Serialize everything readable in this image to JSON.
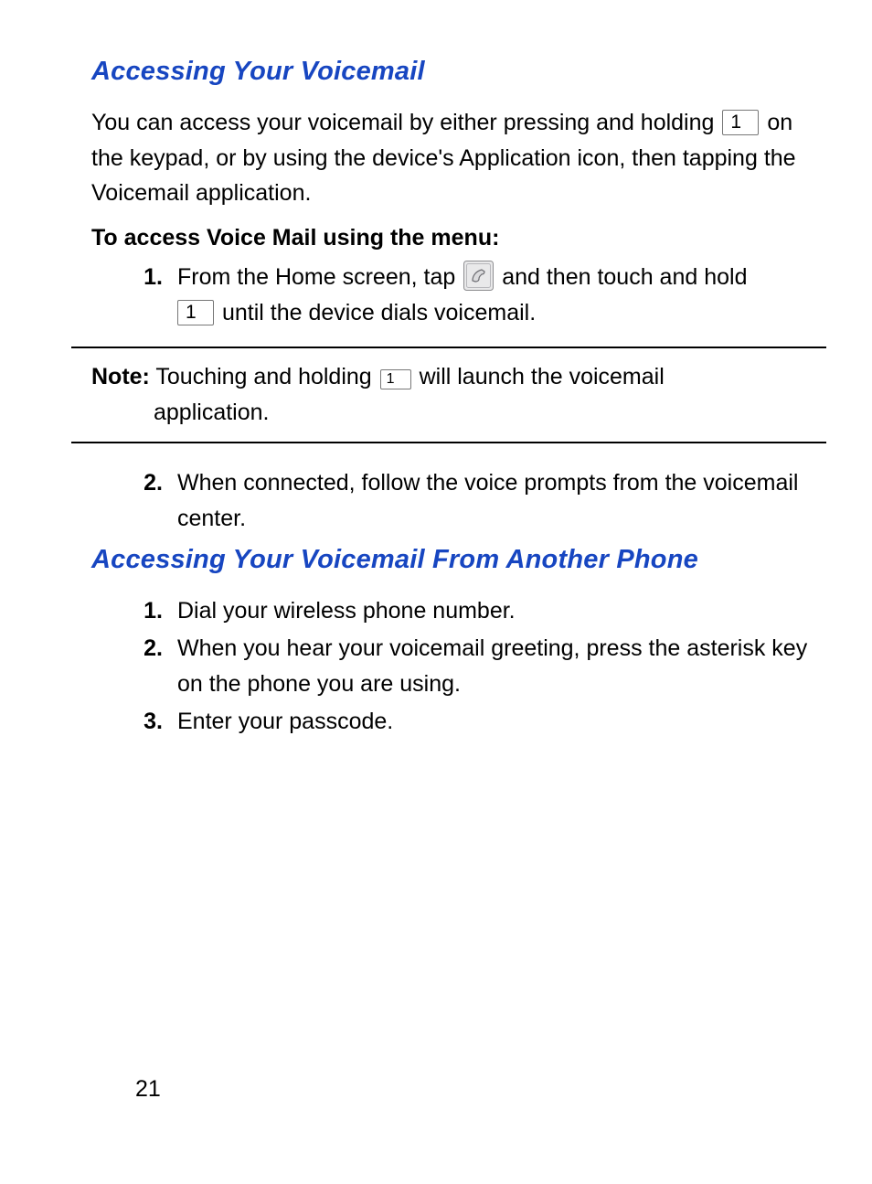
{
  "section1": {
    "title": "Accessing Your Voicemail",
    "intro_a": "You can access your voicemail by either pressing and holding ",
    "key1": "1",
    "intro_b": " on the keypad, or by using the device's Application icon, then tapping the Voicemail application.",
    "subhead": "To access Voice Mail using the menu:",
    "step1_num": "1.",
    "step1_a": "From the Home screen, tap ",
    "step1_b": " and then touch and hold ",
    "step1_key": "1",
    "step1_c": " until the device dials voicemail.",
    "note_label": "Note:",
    "note_a": " Touching and holding ",
    "note_key": "1",
    "note_b": " will launch the voicemail ",
    "note_c": "application.",
    "step2_num": "2.",
    "step2": "When connected, follow the voice prompts from the voicemail center."
  },
  "section2": {
    "title": "Accessing Your Voicemail From Another Phone",
    "steps": [
      {
        "num": "1.",
        "text": "Dial your wireless phone number."
      },
      {
        "num": "2.",
        "text": "When you hear your voicemail greeting, press the asterisk key on the phone you are using."
      },
      {
        "num": "3.",
        "text": "Enter your passcode."
      }
    ]
  },
  "page_number": "21"
}
